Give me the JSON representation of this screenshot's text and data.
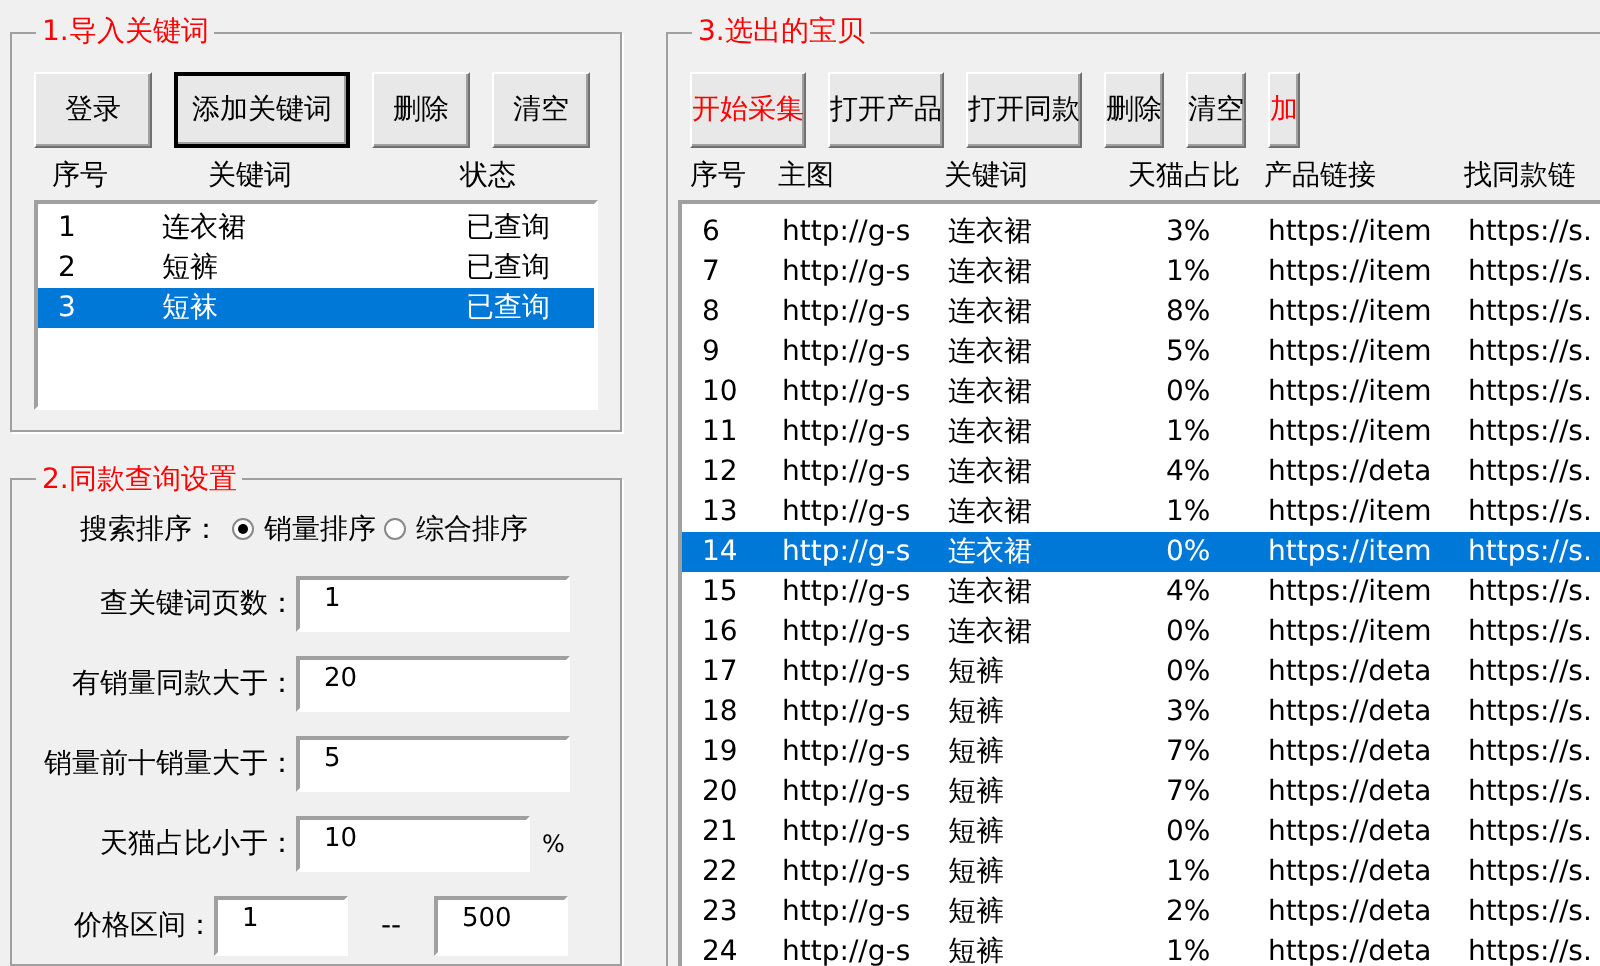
{
  "keyword_group": {
    "title": "1.导入关键词",
    "buttons": [
      {
        "label": "登录",
        "default": false
      },
      {
        "label": "添加关键词",
        "default": true
      },
      {
        "label": "删除",
        "default": false
      },
      {
        "label": "清空",
        "default": false
      }
    ],
    "columns": [
      "序号",
      "关键词",
      "状态"
    ],
    "rows": [
      {
        "index": "1",
        "keyword": "连衣裙",
        "status": "已查询",
        "selected": false
      },
      {
        "index": "2",
        "keyword": "短裤",
        "status": "已查询",
        "selected": false
      },
      {
        "index": "3",
        "keyword": "短袜",
        "status": "已查询",
        "selected": true
      }
    ]
  },
  "settings_group": {
    "title": "2.同款查询设置",
    "sort_label": "搜索排序：",
    "sort_options": [
      {
        "label": "销量排序",
        "selected": true
      },
      {
        "label": "综合排序",
        "selected": false
      }
    ],
    "fields": [
      {
        "label": "查关键词页数：",
        "value": "1"
      },
      {
        "label": "有销量同款大于：",
        "value": "20"
      },
      {
        "label": "销量前十销量大于：",
        "value": "5"
      },
      {
        "label": "天猫占比小于：",
        "value": "10",
        "unit": "%"
      }
    ],
    "price": {
      "label": "价格区间：",
      "min": "1",
      "separator": "--",
      "max": "500"
    }
  },
  "results_group": {
    "title": "3.选出的宝贝",
    "buttons": [
      {
        "label": "开始采集",
        "accent": true
      },
      {
        "label": "打开产品",
        "accent": false
      },
      {
        "label": "打开同款",
        "accent": false
      },
      {
        "label": "删除",
        "accent": false
      },
      {
        "label": "清空",
        "accent": false
      },
      {
        "label": "加",
        "accent": true
      }
    ],
    "columns": [
      "序号",
      "主图",
      "关键词",
      "天猫占比",
      "产品链接",
      "找同款链"
    ],
    "rows": [
      {
        "cells": [
          "6",
          "http://g-s",
          "连衣裙",
          "3%",
          "https://item",
          "https://s."
        ],
        "selected": false
      },
      {
        "cells": [
          "7",
          "http://g-s",
          "连衣裙",
          "1%",
          "https://item",
          "https://s."
        ],
        "selected": false
      },
      {
        "cells": [
          "8",
          "http://g-s",
          "连衣裙",
          "8%",
          "https://item",
          "https://s."
        ],
        "selected": false
      },
      {
        "cells": [
          "9",
          "http://g-s",
          "连衣裙",
          "5%",
          "https://item",
          "https://s."
        ],
        "selected": false
      },
      {
        "cells": [
          "10",
          "http://g-s",
          "连衣裙",
          "0%",
          "https://item",
          "https://s."
        ],
        "selected": false
      },
      {
        "cells": [
          "11",
          "http://g-s",
          "连衣裙",
          "1%",
          "https://item",
          "https://s."
        ],
        "selected": false
      },
      {
        "cells": [
          "12",
          "http://g-s",
          "连衣裙",
          "4%",
          "https://deta",
          "https://s."
        ],
        "selected": false
      },
      {
        "cells": [
          "13",
          "http://g-s",
          "连衣裙",
          "1%",
          "https://item",
          "https://s."
        ],
        "selected": false
      },
      {
        "cells": [
          "14",
          "http://g-s",
          "连衣裙",
          "0%",
          "https://item",
          "https://s."
        ],
        "selected": true
      },
      {
        "cells": [
          "15",
          "http://g-s",
          "连衣裙",
          "4%",
          "https://item",
          "https://s."
        ],
        "selected": false
      },
      {
        "cells": [
          "16",
          "http://g-s",
          "连衣裙",
          "0%",
          "https://item",
          "https://s."
        ],
        "selected": false
      },
      {
        "cells": [
          "17",
          "http://g-s",
          "短裤",
          "0%",
          "https://deta",
          "https://s."
        ],
        "selected": false
      },
      {
        "cells": [
          "18",
          "http://g-s",
          "短裤",
          "3%",
          "https://deta",
          "https://s."
        ],
        "selected": false
      },
      {
        "cells": [
          "19",
          "http://g-s",
          "短裤",
          "7%",
          "https://deta",
          "https://s."
        ],
        "selected": false
      },
      {
        "cells": [
          "20",
          "http://g-s",
          "短裤",
          "7%",
          "https://deta",
          "https://s."
        ],
        "selected": false
      },
      {
        "cells": [
          "21",
          "http://g-s",
          "短裤",
          "0%",
          "https://deta",
          "https://s."
        ],
        "selected": false
      },
      {
        "cells": [
          "22",
          "http://g-s",
          "短裤",
          "1%",
          "https://deta",
          "https://s."
        ],
        "selected": false
      },
      {
        "cells": [
          "23",
          "http://g-s",
          "短裤",
          "2%",
          "https://deta",
          "https://s."
        ],
        "selected": false
      },
      {
        "cells": [
          "24",
          "http://g-s",
          "短裤",
          "1%",
          "https://deta",
          "https://s."
        ],
        "selected": false
      }
    ]
  }
}
